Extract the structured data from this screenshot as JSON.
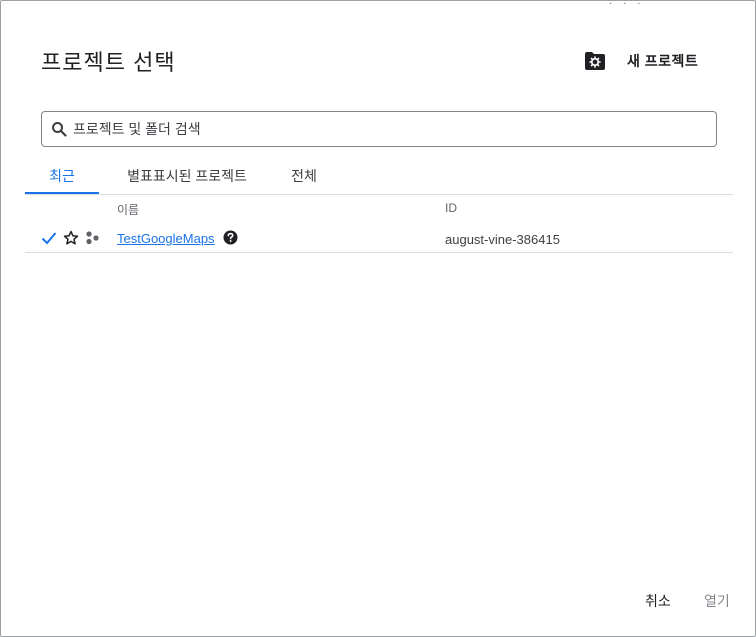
{
  "dialog": {
    "title": "프로젝트 선택",
    "new_project_label": "새 프로젝트",
    "top_fragment": "· · ·"
  },
  "search": {
    "placeholder": "프로젝트 및 폴더 검색",
    "value": ""
  },
  "tabs": [
    {
      "label": "최근",
      "active": true
    },
    {
      "label": "별표표시된 프로젝트",
      "active": false
    },
    {
      "label": "전체",
      "active": false
    }
  ],
  "table": {
    "columns": [
      "이름",
      "ID"
    ],
    "rows": [
      {
        "name": "TestGoogleMaps",
        "id": "august-vine-386415",
        "selected": true,
        "starred": false
      }
    ]
  },
  "footer": {
    "cancel_label": "취소",
    "open_label": "열기"
  },
  "colors": {
    "accent": "#1a73e8",
    "border": "#dadce0",
    "text": "#202124",
    "disabled": "#80868b"
  }
}
